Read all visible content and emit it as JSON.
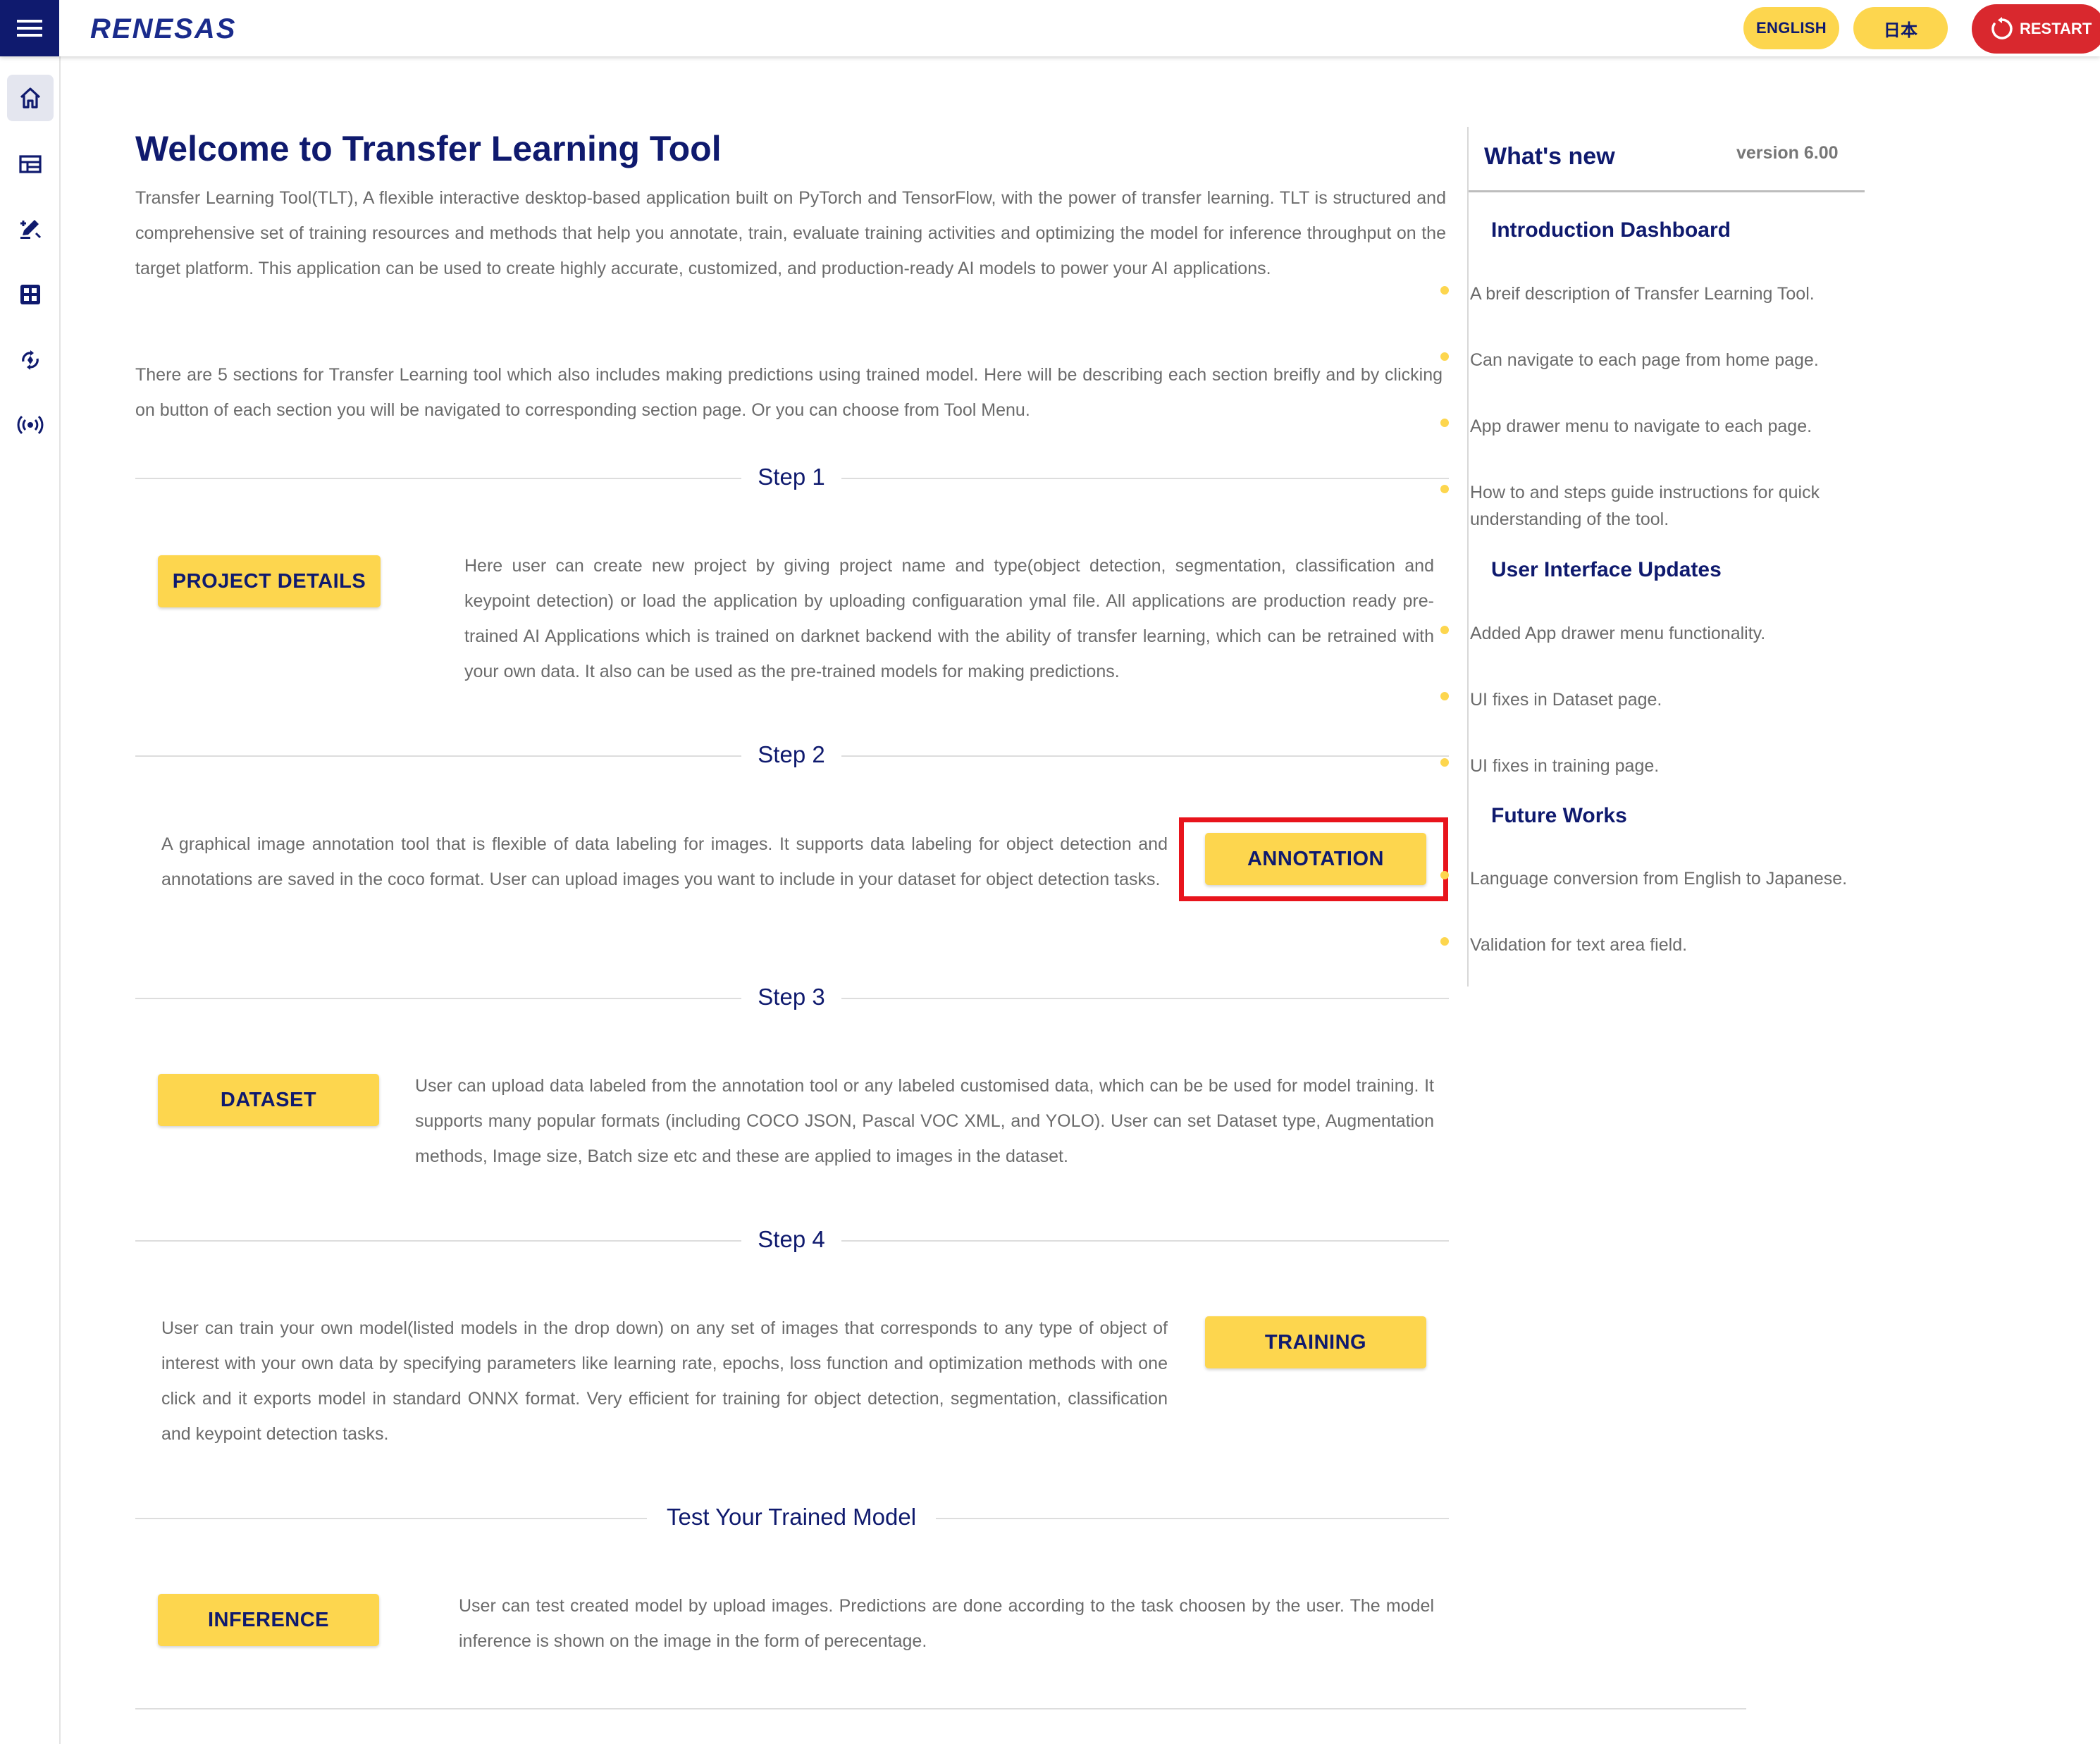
{
  "header": {
    "brand": "RENESAS",
    "lang_english": "ENGLISH",
    "lang_japanese": "日本",
    "restart": "RESTART"
  },
  "siderail": {
    "items": [
      "home-icon",
      "dashboard-table-icon",
      "annotation-pen-icon",
      "dataset-grid-icon",
      "training-icon",
      "inference-broadcast-icon"
    ]
  },
  "main": {
    "title": "Welcome to Transfer Learning Tool",
    "intro1": "Transfer Learning Tool(TLT), A flexible interactive desktop-based application built on PyTorch and TensorFlow, with the power of transfer learning. TLT is structured and comprehensive set of training resources and methods that help you annotate, train, evaluate training activities and optimizing the model for inference throughput on the target platform. This application can be used to create highly accurate, customized, and production-ready AI models to power your AI applications.",
    "intro2": "There are 5 sections for Transfer Learning tool which also includes making predictions using trained model. Here will be describing each section breifly and by clicking on button of each section you will be navigated to corresponding section page. Or you can choose from Tool Menu.",
    "steps": [
      {
        "label": "Step 1",
        "button": "PROJECT DETAILS",
        "desc": "Here user can create new project by giving project name and type(object detection, segmentation, classification and keypoint detection) or load the application by uploading configuaration ymal file. All applications are production ready pre-trained AI Applications which is trained on darknet backend with the ability of transfer learning, which can be retrained with your own data. It also can be used as the pre-trained models for making predictions."
      },
      {
        "label": "Step 2",
        "button": "ANNOTATION",
        "desc": "A graphical image annotation tool that is flexible of data labeling for images. It supports data labeling for object detection and annotations are saved in the coco format. User can upload images you want to include in your dataset for object detection tasks."
      },
      {
        "label": "Step 3",
        "button": "DATASET",
        "desc": "User can upload data labeled from the annotation tool or any labeled customised data, which can be be used for model training. It supports many popular formats (including COCO JSON, Pascal VOC XML, and YOLO). User can set Dataset type, Augmentation methods, Image size, Batch size etc and these are applied to images in the dataset."
      },
      {
        "label": "Step 4",
        "button": "TRAINING",
        "desc": "User can train your own model(listed models in the drop down) on any set of images that corresponds to any type of object of interest with your own data by specifying parameters like learning rate, epochs, loss function and optimization methods with one click and it exports model in standard ONNX format. Very efficient for training for object detection, segmentation, classification and keypoint detection tasks."
      },
      {
        "label": "Test Your Trained Model",
        "button": "INFERENCE",
        "desc": "User can test created model by upload images. Predictions are done according to the task choosen by the user. The model inference is shown on the image in the form of perecentage."
      }
    ]
  },
  "whats_new": {
    "title": "What's new",
    "version": "version 6.00",
    "sections": [
      {
        "heading": "Introduction Dashboard",
        "items": [
          "A breif description of Transfer Learning Tool.",
          "Can navigate to each page from home page.",
          "App drawer menu to navigate to each page.",
          "How to and steps guide instructions for quick understanding of the tool."
        ]
      },
      {
        "heading": "User Interface Updates",
        "items": [
          "Added App drawer menu functionality.",
          "UI fixes in Dataset page.",
          "UI fixes in training page."
        ]
      },
      {
        "heading": "Future Works",
        "items": [
          "Language conversion from English to Japanese.",
          "Validation for text area field."
        ]
      }
    ]
  },
  "colors": {
    "navy": "#0f1a6e",
    "yellow": "#fdd64e",
    "restart_red": "#d9282e",
    "highlight_red": "#e8141c",
    "body_text": "#6b6b6b"
  }
}
